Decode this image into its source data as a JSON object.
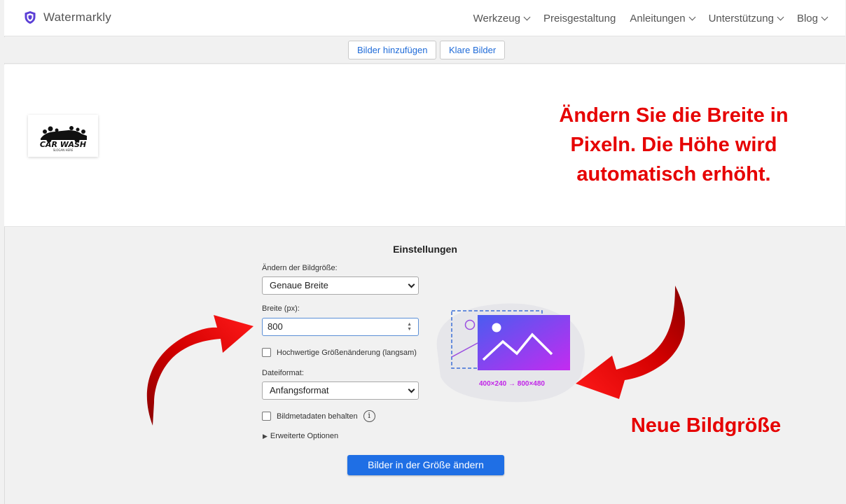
{
  "header": {
    "brand": "Watermarkly",
    "nav": [
      {
        "label": "Werkzeug",
        "dropdown": true
      },
      {
        "label": "Preisgestaltung",
        "dropdown": false
      },
      {
        "label": "Anleitungen",
        "dropdown": true
      },
      {
        "label": "Unterstützung",
        "dropdown": true
      },
      {
        "label": "Blog",
        "dropdown": true
      }
    ]
  },
  "toolbar": {
    "add_label": "Bilder hinzufügen",
    "clear_label": "Klare Bilder"
  },
  "preview": {
    "thumbnail_logo_text": "CAR WASH",
    "thumbnail_logo_tagline": "SLOGAN HERE"
  },
  "annotations": {
    "top": "Ändern Sie die Breite in Pixeln. Die Höhe wird automatisch erhöht.",
    "bottom": "Neue Bildgröße",
    "color": "#e60000"
  },
  "settings": {
    "title": "Einstellungen",
    "resize_label": "Ändern der Bildgröße:",
    "resize_value": "Genaue Breite",
    "width_label": "Breite (px):",
    "width_value": "800",
    "hq_label": "Hochwertige Größenänderung (langsam)",
    "hq_checked": false,
    "format_label": "Dateiformat:",
    "format_value": "Anfangsformat",
    "metadata_label": "Bildmetadaten behalten",
    "metadata_checked": false,
    "advanced_label": "Erweiterte Optionen",
    "submit_label": "Bilder in der Größe ändern"
  },
  "illustration": {
    "dims_text": "400×240 → 800×480"
  },
  "colors": {
    "accent": "#1f6fe5",
    "link": "#1f6bd8",
    "gradient_start": "#4a5cf0",
    "gradient_end": "#c42bf0"
  }
}
